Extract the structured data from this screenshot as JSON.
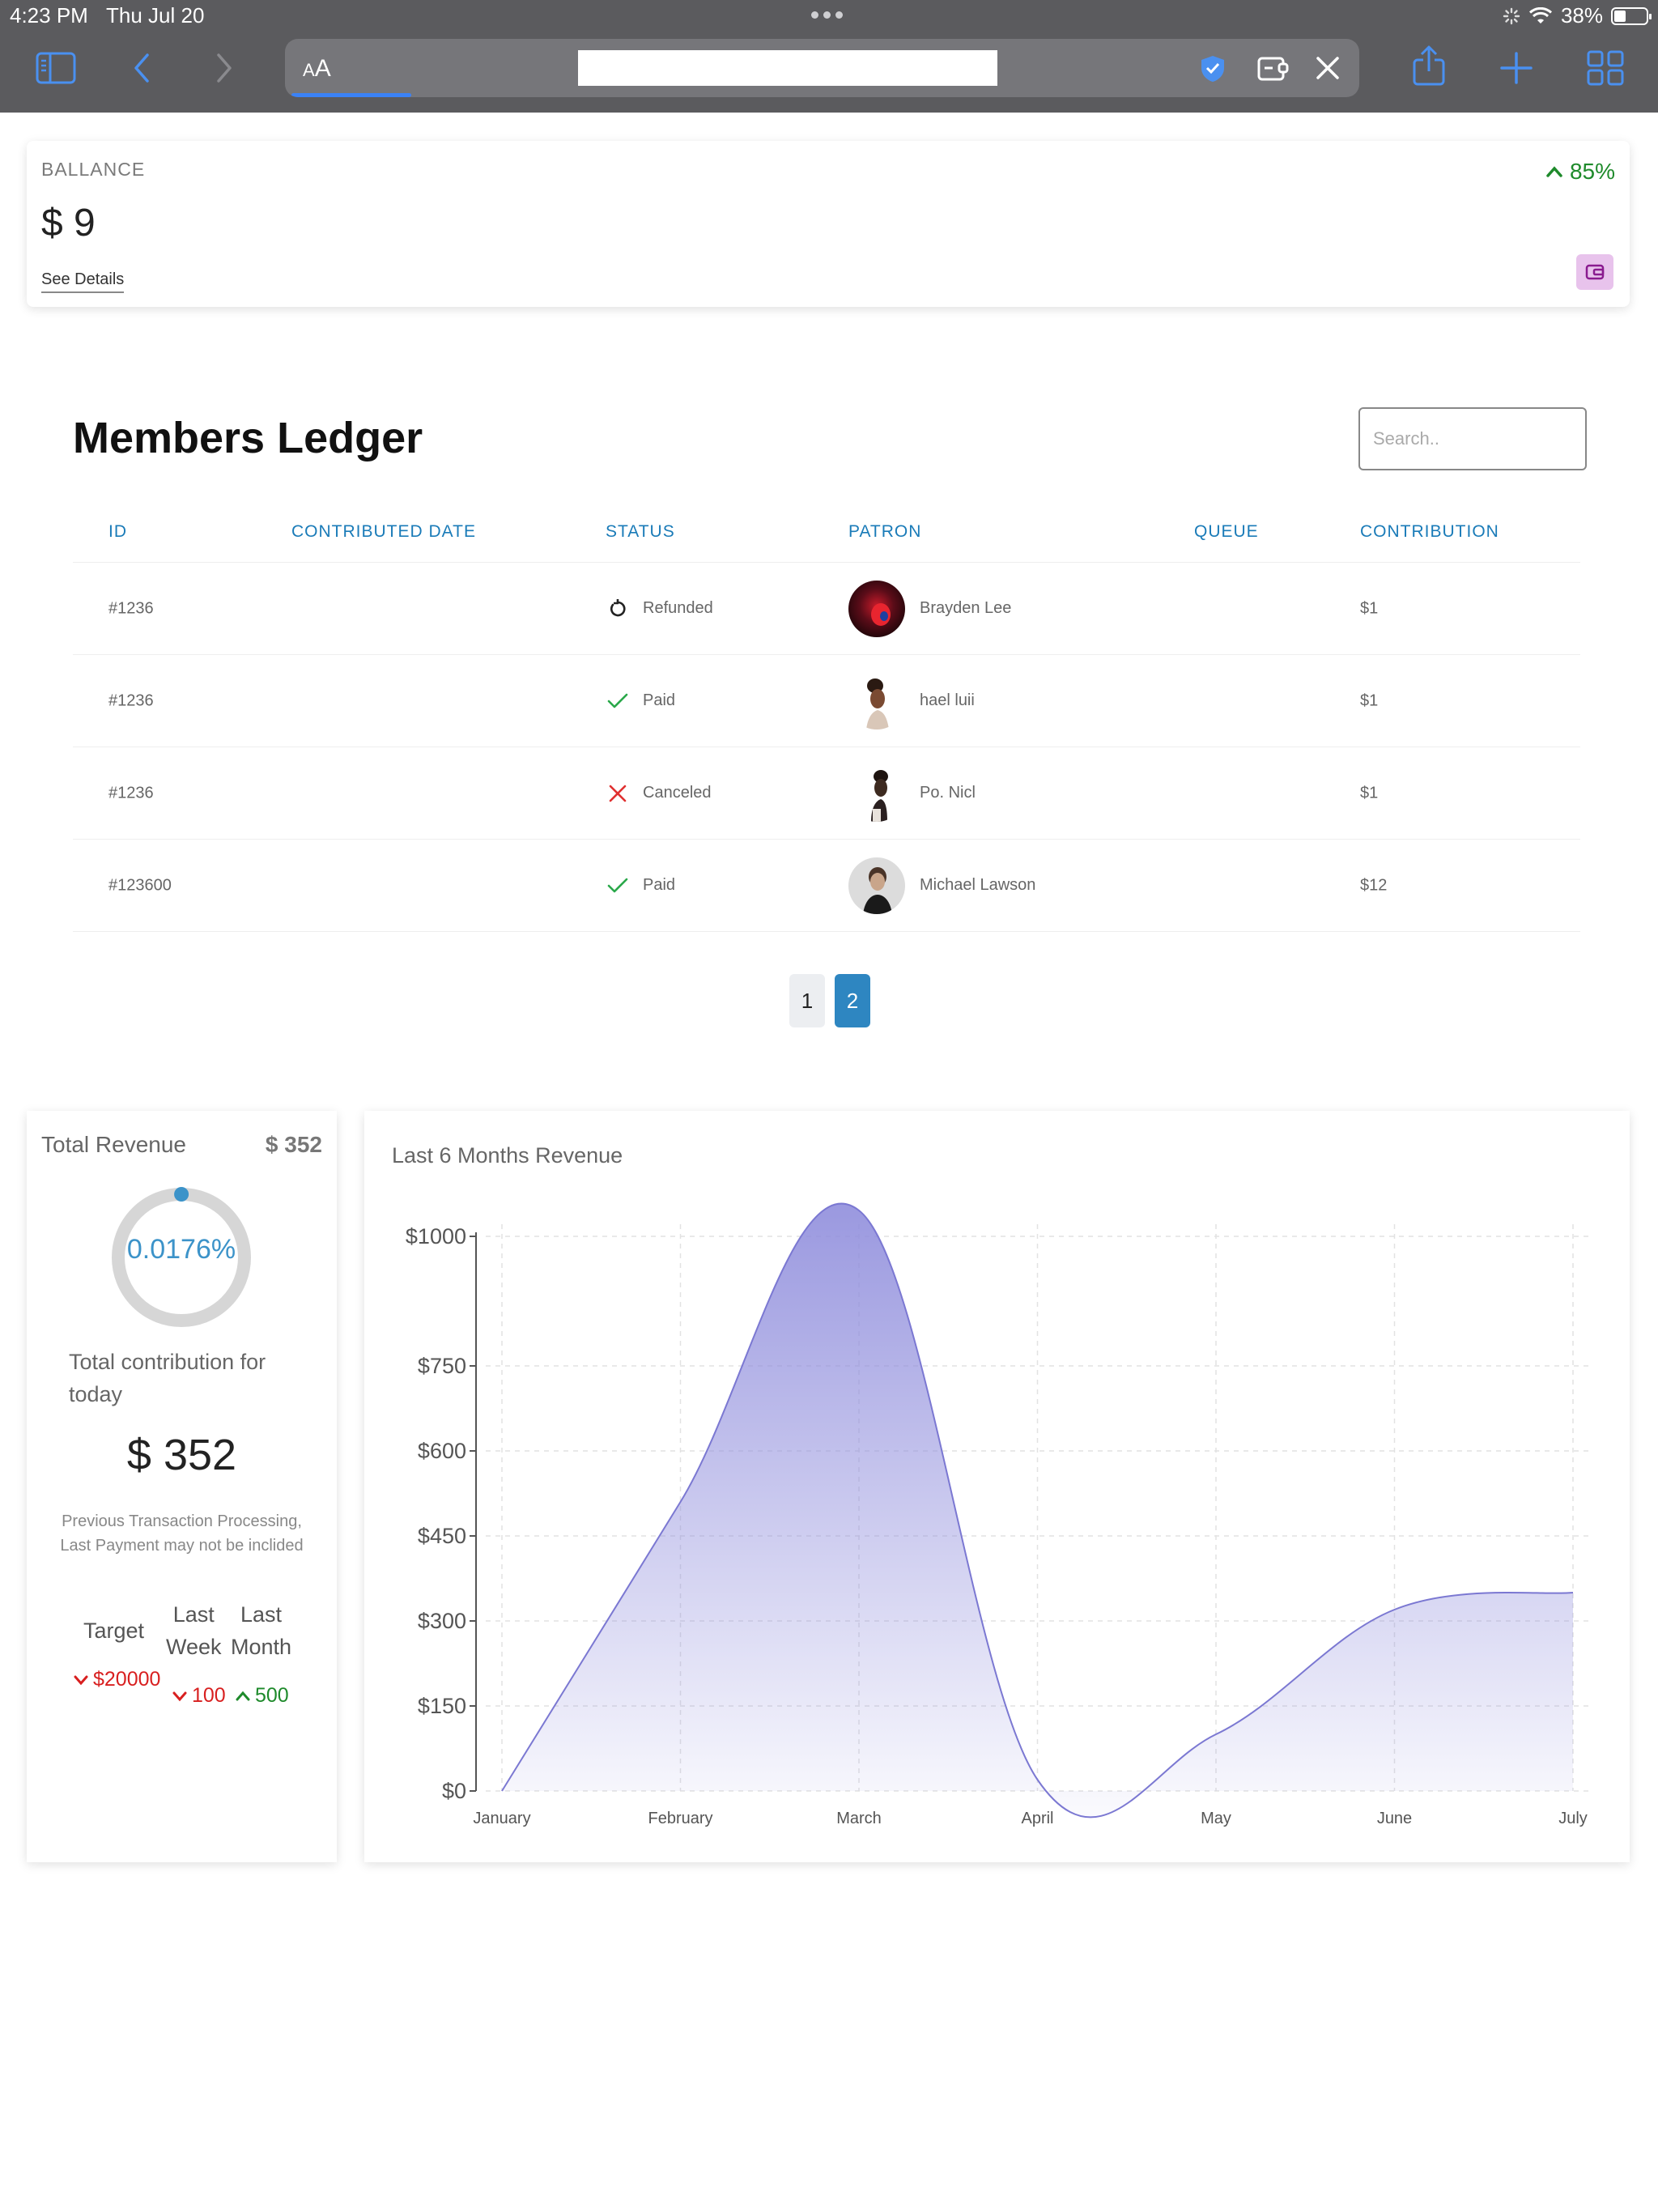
{
  "status_bar": {
    "time": "4:23 PM",
    "date": "Thu Jul 20",
    "battery": "38%",
    "battery_level": 0.38
  },
  "browser": {
    "text_size_label": "AA"
  },
  "balance": {
    "label": "BALLANCE",
    "value": "$ 9",
    "details_link": "See Details",
    "change": "85%"
  },
  "ledger": {
    "title": "Members Ledger",
    "search_placeholder": "Search..",
    "columns": [
      "ID",
      "CONTRIBUTED DATE",
      "STATUS",
      "PATRON",
      "QUEUE",
      "CONTRIBUTION"
    ],
    "rows": [
      {
        "id": "#1236",
        "date": "",
        "status": "Refunded",
        "status_icon": "refund-icon",
        "patron": "Brayden Lee",
        "queue": "",
        "contribution": "$1"
      },
      {
        "id": "#1236",
        "date": "",
        "status": "Paid",
        "status_icon": "check-icon",
        "patron": "hael luii",
        "queue": "",
        "contribution": "$1"
      },
      {
        "id": "#1236",
        "date": "",
        "status": "Canceled",
        "status_icon": "cross-icon",
        "patron": "Po. Nicl",
        "queue": "",
        "contribution": "$1"
      },
      {
        "id": "#123600",
        "date": "",
        "status": "Paid",
        "status_icon": "check-icon",
        "patron": "Michael Lawson",
        "queue": "",
        "contribution": "$12"
      }
    ],
    "pages": [
      "1",
      "2"
    ],
    "active_page": "2"
  },
  "revenue": {
    "title": "Total Revenue",
    "total": "$ 352",
    "percent": "0.0176%",
    "percent_value": 0.0176,
    "contrib_label": "Total contribution for today",
    "contrib_value": "$ 352",
    "note": "Previous Transaction Processing, Last Payment may not be inclided",
    "target_label": "Target",
    "target_value": "$20000",
    "last_week_label_1": "Last",
    "last_week_label_2": "Week",
    "last_week_value": "100",
    "last_month_label_1": "Last",
    "last_month_label_2": "Month",
    "last_month_value": "500"
  },
  "chart_data": {
    "type": "area",
    "title": "Last 6 Months Revenue",
    "categories": [
      "January",
      "February",
      "March",
      "April",
      "May",
      "June",
      "July"
    ],
    "values": [
      0,
      510,
      1050,
      20,
      100,
      320,
      350
    ],
    "yticks": [
      "$0",
      "$150",
      "$300",
      "$450",
      "$600",
      "$750",
      "$1000"
    ],
    "ytick_values": [
      0,
      150,
      300,
      450,
      600,
      750,
      1000
    ],
    "ylim": [
      0,
      1000
    ],
    "grid": true,
    "color": "#8f8ddc"
  }
}
